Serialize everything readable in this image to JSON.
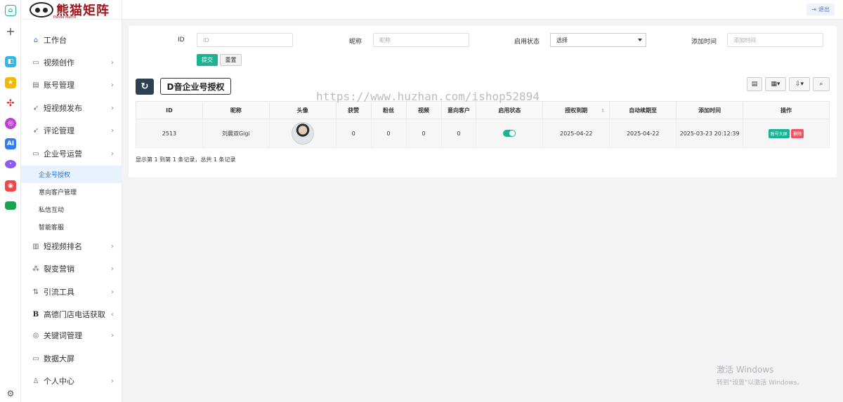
{
  "rail": {
    "items": [
      "home-icon",
      "add-icon",
      "app-icon-1",
      "app-icon-2",
      "app-icon-3",
      "app-icon-4",
      "app-icon-5",
      "app-icon-6",
      "app-icon-7",
      "app-icon-8",
      "settings-icon"
    ],
    "colors": [
      "#30b9e6",
      "#f5b800",
      "#d9261c",
      "#c23dd6",
      "#2f7cf6",
      "#8a5cf6",
      "#f04848",
      "#1aa352"
    ]
  },
  "logo": {
    "name": "熊猫矩阵",
    "sub": "Panda Matrix"
  },
  "sidebar": {
    "items": [
      {
        "label": "工作台",
        "icon": "home-icon"
      },
      {
        "label": "视频创作",
        "icon": "video-icon"
      },
      {
        "label": "账号管理",
        "icon": "account-icon"
      },
      {
        "label": "短视频发布",
        "icon": "send-icon"
      },
      {
        "label": "评论管理",
        "icon": "comment-icon"
      },
      {
        "label": "企业号运营",
        "icon": "enterprise-icon"
      },
      {
        "label": "短视频排名",
        "icon": "bar-chart-icon"
      },
      {
        "label": "裂变营销",
        "icon": "sitemap-icon"
      },
      {
        "label": "引流工具",
        "icon": "sort-icon"
      },
      {
        "label": "高德门店电话获取",
        "icon": "bold-b-icon"
      },
      {
        "label": "关键词管理",
        "icon": "tag-icon"
      },
      {
        "label": "数据大屏",
        "icon": "screen-icon"
      },
      {
        "label": "个人中心",
        "icon": "user-icon"
      }
    ],
    "subitems": [
      {
        "label": "企业号授权",
        "active": true
      },
      {
        "label": "意向客户管理"
      },
      {
        "label": "私信互动"
      },
      {
        "label": "智能客服"
      }
    ]
  },
  "topbar": {
    "logout": "退出"
  },
  "filters": {
    "id_label": "ID",
    "id_placeholder": "ID",
    "nick_label": "昵称",
    "nick_placeholder": "昵称",
    "status_label": "启用状态",
    "status_value": "选择",
    "time_label": "添加时间",
    "time_placeholder": "添加时间",
    "submit": "提交",
    "reset": "重置"
  },
  "toolbar": {
    "refresh_icon": "refresh-icon",
    "auth_button": "D音企业号授权"
  },
  "watermark": "https://www.huzhan.com/ishop52894",
  "table": {
    "headers": [
      "ID",
      "昵称",
      "头像",
      "获赞",
      "粉丝",
      "视频",
      "意向客户",
      "启用状态",
      "授权到期",
      "自动续期至",
      "添加时间",
      "操作"
    ],
    "rows": [
      {
        "id": "2513",
        "nickname": "刘晨双Gigi",
        "likes": "0",
        "fans": "0",
        "videos": "0",
        "leads": "0",
        "enabled": true,
        "auth_expiry": "2025-04-22",
        "renew_until": "2025-04-22",
        "added": "2025-03-23 20:12:39",
        "act_screen": "账号大屏",
        "act_delete": "删除"
      }
    ]
  },
  "pager": "显示第 1 到第 1 条记录，总共 1 条记录",
  "windows": {
    "title": "激活 Windows",
    "sub": "转到\"设置\"以激活 Windows。"
  }
}
